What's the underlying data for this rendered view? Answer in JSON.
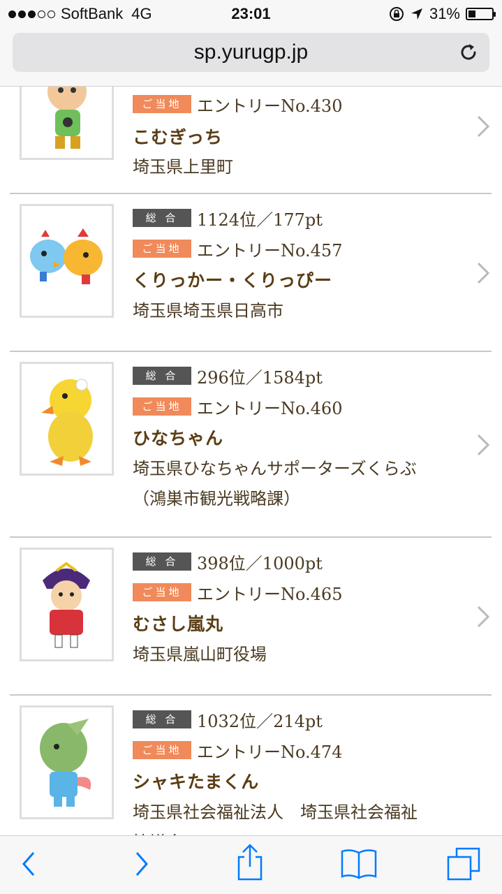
{
  "status_bar": {
    "carrier": "SoftBank",
    "network": "4G",
    "time": "23:01",
    "battery": "31%",
    "battery_level": 0.31
  },
  "address_bar": {
    "url": "sp.yurugp.jp"
  },
  "badges": {
    "overall": "総 合",
    "local": "ご当地"
  },
  "items": [
    {
      "rank": "",
      "entry": "エントリーNo.430",
      "name": "こむぎっち",
      "org": "埼玉県上里町",
      "org2": ""
    },
    {
      "rank": "1124位／177pt",
      "entry": "エントリーNo.457",
      "name": "くりっかー・くりっぴー",
      "org": "埼玉県埼玉県日高市",
      "org2": ""
    },
    {
      "rank": "296位／1584pt",
      "entry": "エントリーNo.460",
      "name": "ひなちゃん",
      "org": "埼玉県ひなちゃんサポーターズくらぶ",
      "org2": "（鴻巣市観光戦略課）"
    },
    {
      "rank": "398位／1000pt",
      "entry": "エントリーNo.465",
      "name": "むさし嵐丸",
      "org": "埼玉県嵐山町役場",
      "org2": ""
    },
    {
      "rank": "1032位／214pt",
      "entry": "エントリーNo.474",
      "name": "シャキたまくん",
      "org": "埼玉県社会福祉法人　埼玉県社会福祉",
      "org2": "協議会"
    }
  ],
  "toolbar": {
    "back_icon": "chevron-left-icon",
    "forward_icon": "chevron-right-icon",
    "share_icon": "share-icon",
    "bookmarks_icon": "book-icon",
    "tabs_icon": "tabs-icon"
  },
  "colors": {
    "accent": "#007aff",
    "badge_overall": "#555555",
    "badge_local": "#f08a5a",
    "name_text": "#5a3d14"
  }
}
